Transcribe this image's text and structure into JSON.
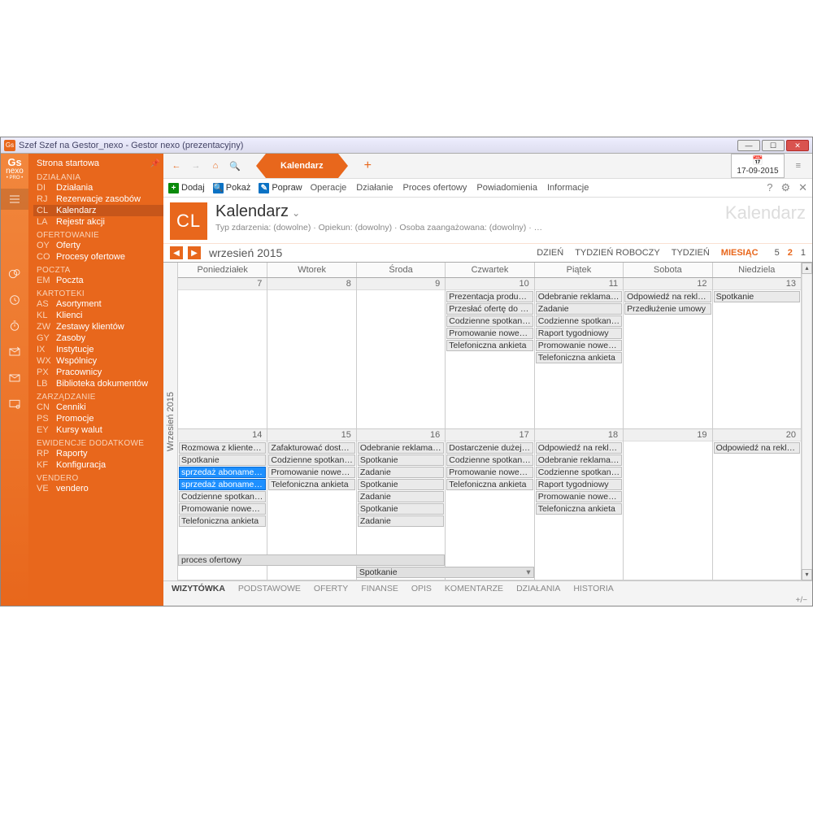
{
  "window_title": "Szef Szef na Gestor_nexo - Gestor nexo (prezentacyjny)",
  "date_display": "17-09-2015",
  "logo": {
    "top": "Gs",
    "mid": "nexo",
    "bot": "• PRO •"
  },
  "sidebar": {
    "start": "Strona startowa",
    "groups": [
      {
        "head": "DZIAŁANIA",
        "items": [
          {
            "code": "DI",
            "label": "Działania"
          },
          {
            "code": "RJ",
            "label": "Rezerwacje zasobów"
          },
          {
            "code": "CL",
            "label": "Kalendarz",
            "sel": true
          },
          {
            "code": "LA",
            "label": "Rejestr akcji"
          }
        ]
      },
      {
        "head": "OFERTOWANIE",
        "items": [
          {
            "code": "OY",
            "label": "Oferty"
          },
          {
            "code": "CO",
            "label": "Procesy ofertowe"
          }
        ]
      },
      {
        "head": "POCZTA",
        "items": [
          {
            "code": "EM",
            "label": "Poczta"
          }
        ]
      },
      {
        "head": "KARTOTEKI",
        "items": [
          {
            "code": "AS",
            "label": "Asortyment"
          },
          {
            "code": "KL",
            "label": "Klienci"
          },
          {
            "code": "ZW",
            "label": "Zestawy klientów"
          },
          {
            "code": "GY",
            "label": "Zasoby"
          },
          {
            "code": "IX",
            "label": "Instytucje"
          },
          {
            "code": "WX",
            "label": "Wspólnicy"
          },
          {
            "code": "PX",
            "label": "Pracownicy"
          },
          {
            "code": "LB",
            "label": "Biblioteka dokumentów"
          }
        ]
      },
      {
        "head": "ZARZĄDZANIE",
        "items": [
          {
            "code": "CN",
            "label": "Cenniki"
          },
          {
            "code": "PS",
            "label": "Promocje"
          },
          {
            "code": "EY",
            "label": "Kursy walut"
          }
        ]
      },
      {
        "head": "EWIDENCJE DODATKOWE",
        "items": [
          {
            "code": "RP",
            "label": "Raporty"
          },
          {
            "code": "KF",
            "label": "Konfiguracja"
          }
        ]
      },
      {
        "head": "VENDERO",
        "items": [
          {
            "code": "VE",
            "label": "vendero"
          }
        ]
      }
    ]
  },
  "tab_label": "Kalendarz",
  "toolbar": {
    "add": "Dodaj",
    "show": "Pokaż",
    "edit": "Popraw",
    "items": [
      "Operacje",
      "Działanie",
      "Proces ofertowy",
      "Powiadomienia",
      "Informacje"
    ]
  },
  "header": {
    "badge": "CL",
    "title": "Kalendarz",
    "sub": "Typ zdarzenia: (dowolne) · Opiekun: (dowolny) · Osoba zaangażowana: (dowolny) · …",
    "ghost": "Kalendarz"
  },
  "month": {
    "name": "wrzesień 2015",
    "vlabel": "Wrzesień 2015",
    "views": [
      "DZIEŃ",
      "TYDZIEŃ ROBOCZY",
      "TYDZIEŃ",
      "MIESIĄC"
    ],
    "view_sel": 3,
    "nums": [
      "5",
      "2",
      "1"
    ],
    "num_sel": 1,
    "days": [
      "Poniedziałek",
      "Wtorek",
      "Środa",
      "Czwartek",
      "Piątek",
      "Sobota",
      "Niedziela"
    ]
  },
  "weeks": [
    {
      "days": [
        {
          "n": 7,
          "ev": []
        },
        {
          "n": 8,
          "ev": []
        },
        {
          "n": 9,
          "ev": []
        },
        {
          "n": 10,
          "ev": [
            "Prezentacja produktó…",
            "Przesłać ofertę do fir…",
            "Codzienne spotkanie…",
            "Promowanie noweg…",
            "Telefoniczna ankieta"
          ]
        },
        {
          "n": 11,
          "ev": [
            "Odebranie reklamacji…",
            "Zadanie",
            "Codzienne spotkanie…",
            "Raport tygodniowy",
            "Promowanie noweg…",
            "Telefoniczna ankieta"
          ]
        },
        {
          "n": 12,
          "ev": [
            "Odpowiedź na rekla…",
            "Przedłużenie umowy"
          ]
        },
        {
          "n": 13,
          "ev": [
            "Spotkanie"
          ]
        }
      ]
    },
    {
      "days": [
        {
          "n": 14,
          "ev": [
            "Rozmowa z klientem…",
            "Spotkanie",
            {
              "t": "sprzedaż abonamentu",
              "c": "blue"
            },
            {
              "t": "sprzedaż abonamentu",
              "c": "blue"
            },
            "Codzienne spotkanie…",
            "Promowanie noweg…",
            "Telefoniczna ankieta"
          ]
        },
        {
          "n": 15,
          "ev": [
            "Zafakturować dosta…",
            "Codzienne spotkanie…",
            "Promowanie noweg…",
            "Telefoniczna ankieta"
          ]
        },
        {
          "n": 16,
          "ev": [
            "Odebranie reklamacji…",
            "Spotkanie",
            "Zadanie",
            "Spotkanie",
            "Zadanie",
            "Spotkanie",
            "Zadanie"
          ]
        },
        {
          "n": 17,
          "ev": [
            "Dostarczenie dużej il…",
            "Codzienne spotkanie…",
            "Promowanie noweg…",
            "Telefoniczna ankieta"
          ]
        },
        {
          "n": 18,
          "ev": [
            "Odpowiedź na rekla…",
            "Odebranie reklamacji…",
            "Codzienne spotkanie…",
            "Raport tygodniowy",
            "Promowanie noweg…",
            "Telefoniczna ankieta"
          ]
        },
        {
          "n": 19,
          "ev": []
        },
        {
          "n": 20,
          "ev": [
            "Odpowiedź na rekla…"
          ]
        }
      ],
      "multi": [
        {
          "label": "proces ofertowy",
          "start": 0,
          "span": 3,
          "row": 7
        },
        {
          "label": "Spotkanie",
          "start": 2,
          "span": 2,
          "row": 8,
          "handle": true
        }
      ]
    }
  ],
  "bottom_tabs": [
    "WIZYTÓWKA",
    "PODSTAWOWE",
    "OFERTY",
    "FINANSE",
    "OPIS",
    "KOMENTARZE",
    "DZIAŁANIA",
    "HISTORIA"
  ],
  "bottom_sel": 0,
  "plus_minus": "+/−"
}
